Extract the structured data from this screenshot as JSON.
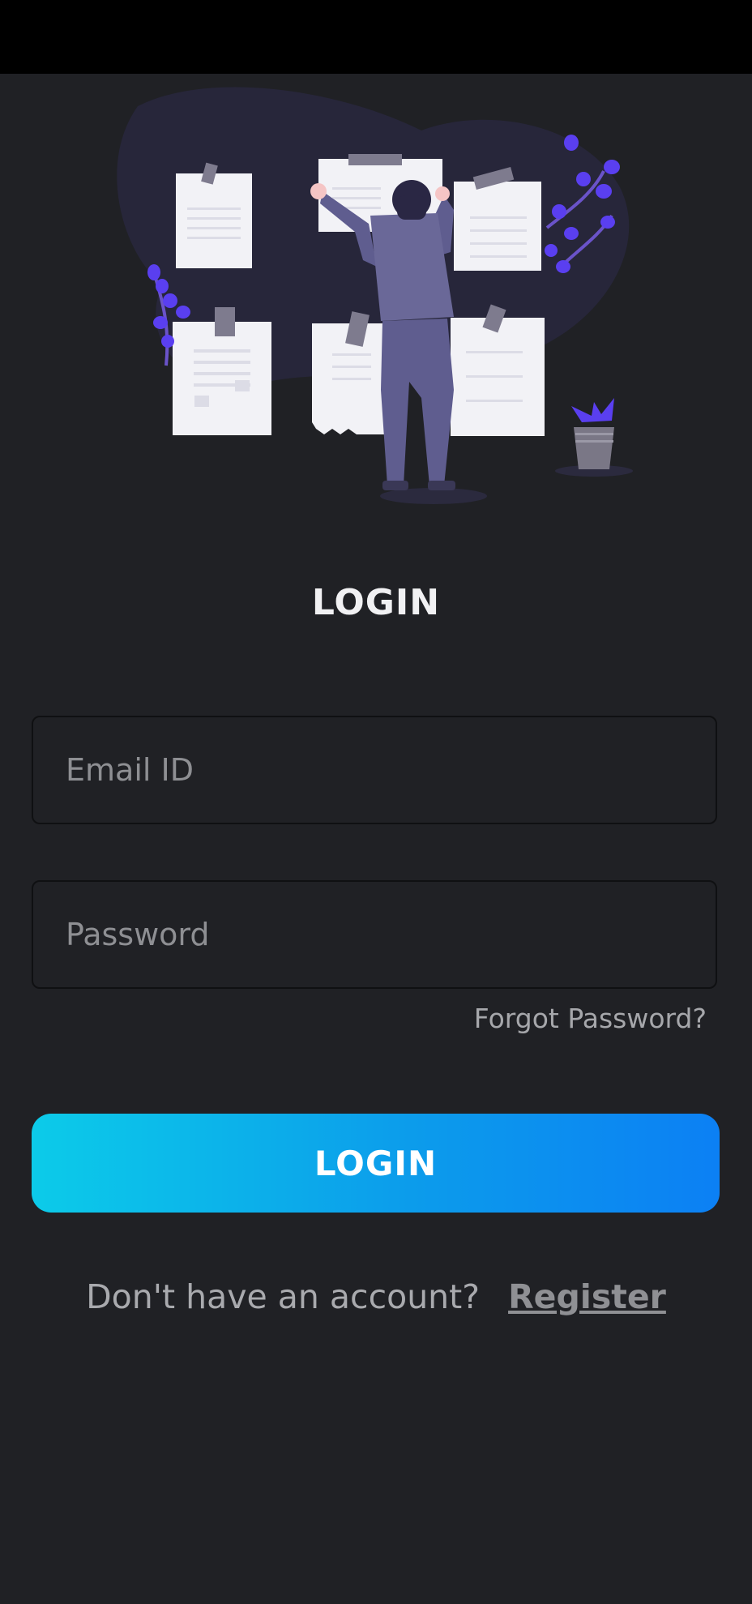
{
  "login": {
    "title": "LOGIN",
    "email": {
      "placeholder": "Email ID",
      "value": ""
    },
    "password": {
      "placeholder": "Password",
      "value": ""
    },
    "forgot_label": "Forgot Password?",
    "button_label": "LOGIN",
    "register_prompt": "Don't have an account?",
    "register_label": "Register"
  },
  "colors": {
    "background": "#202125",
    "status_bar": "#000000",
    "accent_start": "#0ccbe9",
    "accent_end": "#0c80f4",
    "illustration_purple": "#5a3ff0",
    "illustration_figure": "#5f5d8f"
  },
  "icons": [
    "person-illustration",
    "plant-icon",
    "pot-plant-icon"
  ]
}
